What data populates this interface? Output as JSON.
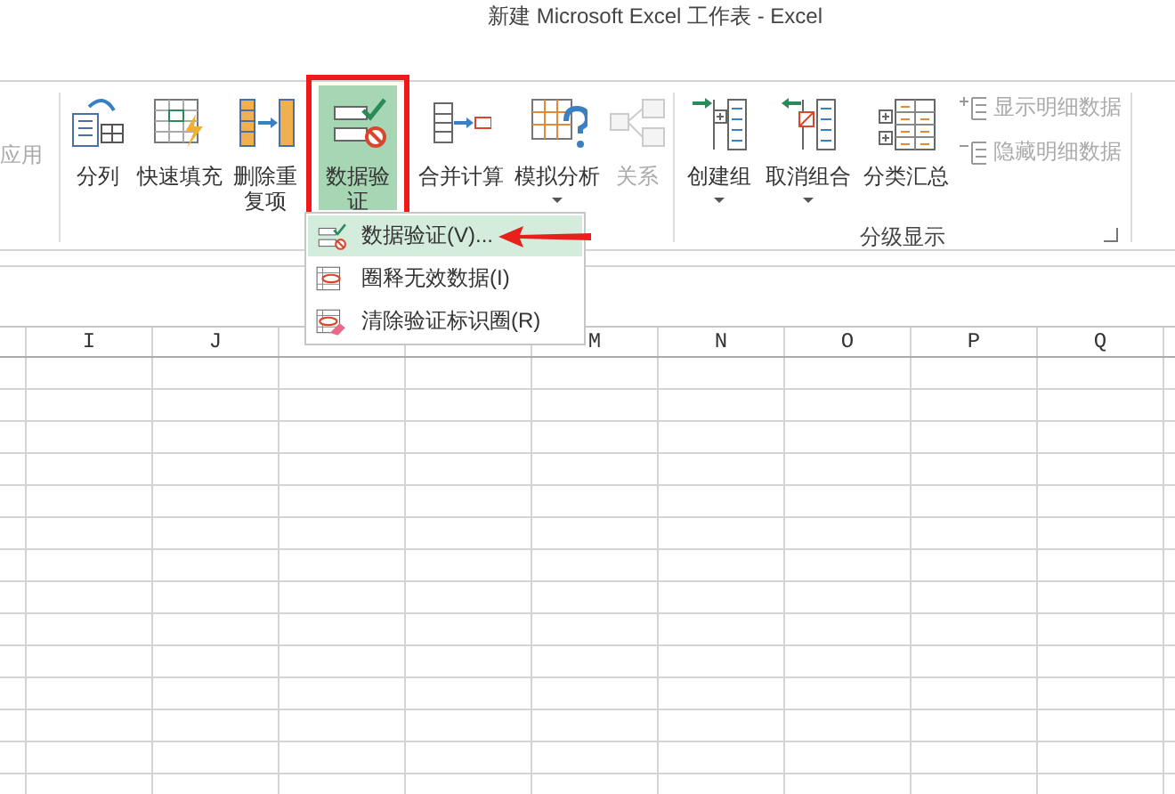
{
  "window": {
    "title": "新建 Microsoft Excel 工作表 - Excel"
  },
  "ribbon": {
    "cut_label": "应用",
    "groups": [
      {
        "buttons": [
          {
            "label": "分列",
            "disabled": false,
            "selected": false,
            "dropdown": false
          },
          {
            "label": "快速填充",
            "disabled": false,
            "selected": false,
            "dropdown": false
          },
          {
            "label": "删除重复项",
            "disabled": false,
            "selected": false,
            "dropdown": false
          },
          {
            "label": "数据验证",
            "disabled": false,
            "selected": true,
            "dropdown": true
          },
          {
            "label": "合并计算",
            "disabled": false,
            "selected": false,
            "dropdown": false
          },
          {
            "label": "模拟分析",
            "disabled": false,
            "selected": false,
            "dropdown": true
          },
          {
            "label": "关系",
            "disabled": true,
            "selected": false,
            "dropdown": false
          }
        ]
      },
      {
        "label": "分级显示",
        "buttons": [
          {
            "label": "创建组",
            "disabled": false,
            "selected": false,
            "dropdown": true
          },
          {
            "label": "取消组合",
            "disabled": false,
            "selected": false,
            "dropdown": true
          },
          {
            "label": "分类汇总",
            "disabled": false,
            "selected": false,
            "dropdown": false
          }
        ],
        "small_buttons": [
          {
            "label": "显示明细数据",
            "disabled": true
          },
          {
            "label": "隐藏明细数据",
            "disabled": true
          }
        ]
      }
    ]
  },
  "menu": {
    "items": [
      {
        "label": "数据验证(V)...",
        "selected": true
      },
      {
        "label": "圈释无效数据(I)",
        "selected": false
      },
      {
        "label": "清除验证标识圈(R)",
        "selected": false
      }
    ]
  },
  "sheet": {
    "columns_left": [
      "I",
      "J"
    ],
    "columns_right": [
      "M",
      "N",
      "O",
      "P",
      "Q"
    ]
  }
}
